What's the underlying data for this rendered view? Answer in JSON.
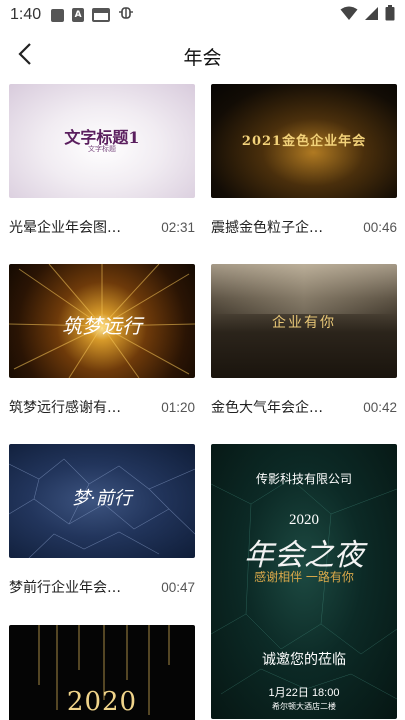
{
  "status": {
    "time": "1:40",
    "left_icons": [
      "square-icon",
      "a-icon",
      "keyboard-box-icon",
      "bug-icon"
    ],
    "right_icons": [
      "wifi-icon",
      "signal-icon",
      "battery-icon"
    ]
  },
  "nav": {
    "title": "年会"
  },
  "videos": [
    {
      "title": "光晕企业年会图…",
      "duration": "02:31",
      "thumb_text": "文字标题1",
      "thumb_sub": "文字标题"
    },
    {
      "title": "震撼金色粒子企…",
      "duration": "00:46",
      "thumb_text": "2021金色企业年会"
    },
    {
      "title": "筑梦远行感谢有…",
      "duration": "01:20",
      "thumb_text": "筑梦远行"
    },
    {
      "title": "金色大气年会企…",
      "duration": "00:42",
      "thumb_text": "企业有你"
    },
    {
      "title": "梦前行企业年会…",
      "duration": "00:47",
      "thumb_text": "梦·前行"
    },
    {
      "title": "",
      "duration": "",
      "thumb_text": "2020"
    }
  ],
  "poster": {
    "company": "传影科技有限公司",
    "year": "2020",
    "headline": "年会之夜",
    "slogan": "感谢相伴 一路有你",
    "invite": "诚邀您的莅临",
    "date": "1月22日 18:00",
    "venue": "希尔顿大酒店二楼"
  },
  "colors": {
    "gold": "#d9a84a",
    "dark_bg": "#111111",
    "teal_bg": "#0c2a26"
  }
}
